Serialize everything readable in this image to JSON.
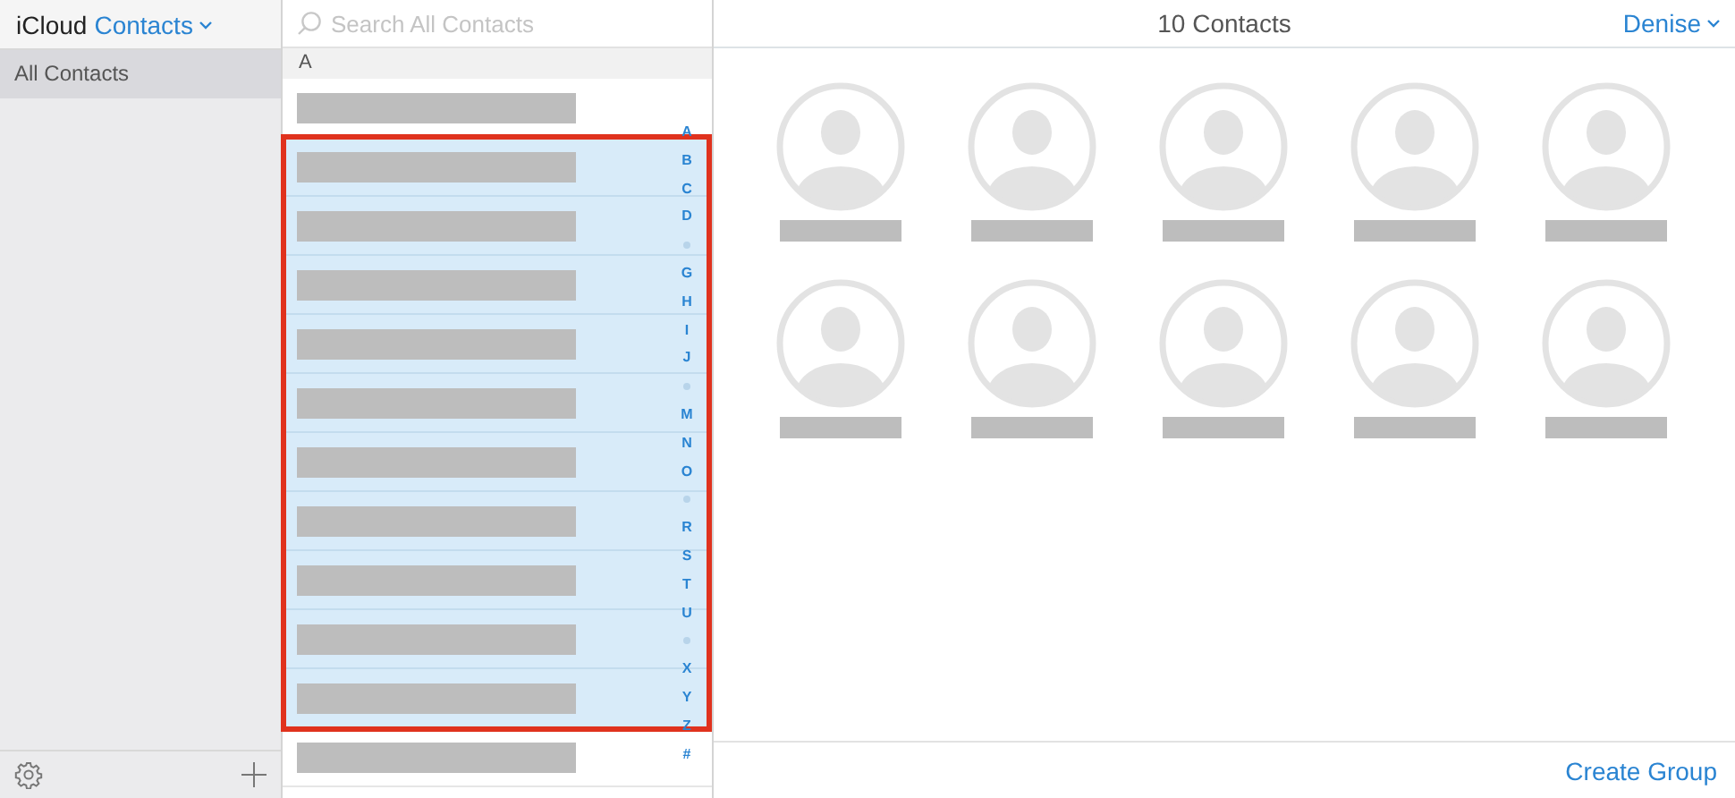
{
  "sidebar": {
    "brand": "iCloud",
    "app_title": "Contacts",
    "groups": [
      {
        "label": "All Contacts",
        "selected": true
      }
    ]
  },
  "search": {
    "placeholder": "Search All Contacts"
  },
  "list": {
    "section": "A",
    "highlight_selected": true,
    "rows": [
      {
        "selected": false
      },
      {
        "selected": true
      },
      {
        "selected": true
      },
      {
        "selected": true
      },
      {
        "selected": true
      },
      {
        "selected": true
      },
      {
        "selected": true
      },
      {
        "selected": true
      },
      {
        "selected": true
      },
      {
        "selected": true
      },
      {
        "selected": true
      },
      {
        "selected": false
      }
    ],
    "index": [
      {
        "label": "A",
        "kind": "letter"
      },
      {
        "label": "B",
        "kind": "letter"
      },
      {
        "label": "C",
        "kind": "letter"
      },
      {
        "label": "D",
        "kind": "letter"
      },
      {
        "kind": "dot"
      },
      {
        "label": "G",
        "kind": "letter"
      },
      {
        "label": "H",
        "kind": "letter"
      },
      {
        "label": "I",
        "kind": "letter"
      },
      {
        "label": "J",
        "kind": "letter"
      },
      {
        "kind": "dot"
      },
      {
        "label": "M",
        "kind": "letter"
      },
      {
        "label": "N",
        "kind": "letter"
      },
      {
        "label": "O",
        "kind": "letter"
      },
      {
        "kind": "dot"
      },
      {
        "label": "R",
        "kind": "letter"
      },
      {
        "label": "S",
        "kind": "letter"
      },
      {
        "label": "T",
        "kind": "letter"
      },
      {
        "label": "U",
        "kind": "letter"
      },
      {
        "kind": "dot"
      },
      {
        "label": "X",
        "kind": "letter"
      },
      {
        "label": "Y",
        "kind": "letter"
      },
      {
        "label": "Z",
        "kind": "letter"
      },
      {
        "label": "#",
        "kind": "letter"
      }
    ]
  },
  "main": {
    "title": "10 Contacts",
    "user": "Denise",
    "create_group": "Create Group",
    "cards": [
      {
        "kind": "placeholder"
      },
      {
        "kind": "placeholder"
      },
      {
        "kind": "placeholder"
      },
      {
        "kind": "placeholder"
      },
      {
        "kind": "placeholder"
      },
      {
        "kind": "placeholder"
      },
      {
        "kind": "placeholder"
      },
      {
        "kind": "placeholder"
      },
      {
        "kind": "placeholder"
      },
      {
        "kind": "placeholder"
      }
    ]
  }
}
